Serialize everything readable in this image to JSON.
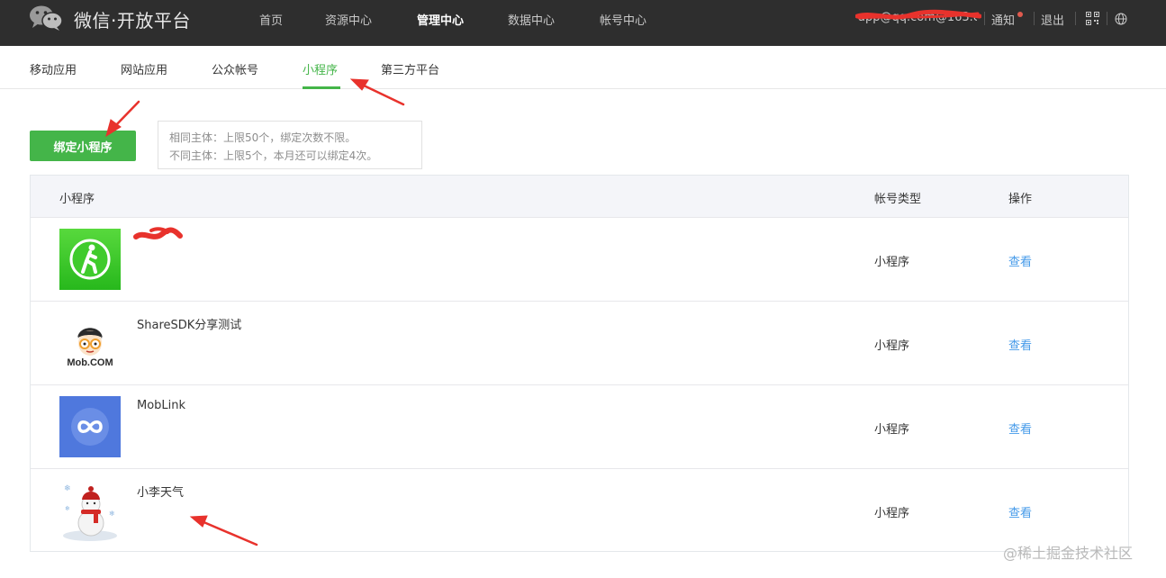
{
  "topbar": {
    "brand": "微信·开放平台",
    "nav": [
      {
        "label": "首页"
      },
      {
        "label": "资源中心"
      },
      {
        "label": "管理中心",
        "active": true
      },
      {
        "label": "数据中心"
      },
      {
        "label": "帐号中心"
      }
    ],
    "account": "app@qq.com@163.com",
    "notice": "通知",
    "logout": "退出",
    "icons": [
      "qrcode-icon",
      "globe-icon"
    ]
  },
  "subtabs": [
    {
      "label": "移动应用"
    },
    {
      "label": "网站应用"
    },
    {
      "label": "公众帐号"
    },
    {
      "label": "小程序",
      "active": true
    },
    {
      "label": "第三方平台"
    }
  ],
  "bind_button": "绑定小程序",
  "tip": {
    "line1": "相同主体：上限50个，绑定次数不限。",
    "line2": "不同主体：上限5个，本月还可以绑定4次。"
  },
  "table": {
    "headers": {
      "app": "小程序",
      "type": "帐号类型",
      "action": "操作"
    },
    "rows": [
      {
        "name": "",
        "type": "小程序",
        "action": "查看",
        "icon": "walking-person-icon"
      },
      {
        "name": "ShareSDK分享测试",
        "type": "小程序",
        "action": "查看",
        "icon": "mob-logo-icon",
        "icon_text": "Mob.COM"
      },
      {
        "name": "MobLink",
        "type": "小程序",
        "action": "查看",
        "icon": "infinity-link-icon"
      },
      {
        "name": "小李天气",
        "type": "小程序",
        "action": "查看",
        "icon": "snowman-icon"
      }
    ]
  },
  "watermark": "@稀土掘金技术社区",
  "colors": {
    "green": "#44b549",
    "link": "#459ae9",
    "topbar": "#2e2e2e",
    "annotation": "#e8322c"
  }
}
